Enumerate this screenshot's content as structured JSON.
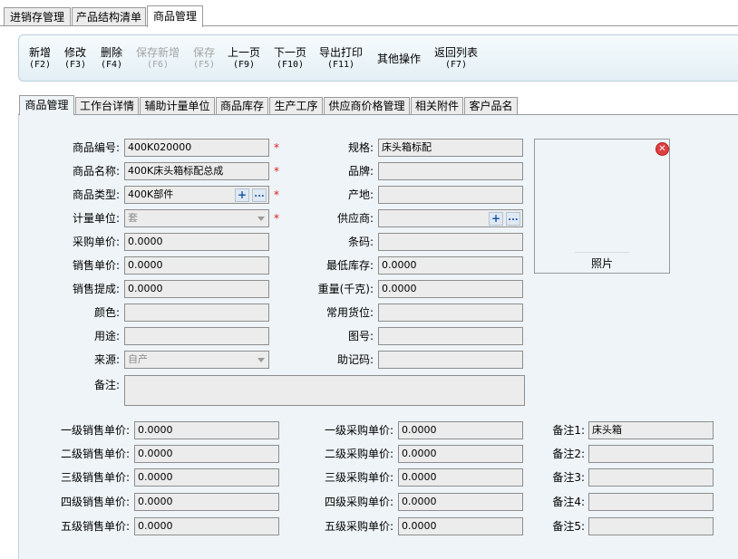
{
  "top_tabs": [
    "进销存管理",
    "产品结构清单",
    "商品管理"
  ],
  "toolbar": {
    "new": {
      "label": "新增",
      "key": "(F2)"
    },
    "edit": {
      "label": "修改",
      "key": "(F3)"
    },
    "delete": {
      "label": "删除",
      "key": "(F4)"
    },
    "save_new": {
      "label": "保存新增",
      "key": "(F6)"
    },
    "save": {
      "label": "保存",
      "key": "(F5)"
    },
    "prev": {
      "label": "上一页",
      "key": "(F9)"
    },
    "next": {
      "label": "下一页",
      "key": "(F10)"
    },
    "export": {
      "label": "导出打印",
      "key": "(F11)"
    },
    "other": {
      "label": "其他操作"
    },
    "back": {
      "label": "返回列表",
      "key": "(F7)"
    }
  },
  "detail_tabs": [
    "商品管理",
    "工作台详情",
    "辅助计量单位",
    "商品库存",
    "生产工序",
    "供应商价格管理",
    "相关附件",
    "客户品名"
  ],
  "form": {
    "code": {
      "label": "商品编号:",
      "value": "400K020000"
    },
    "name": {
      "label": "商品名称:",
      "value": "400K床头箱标配总成"
    },
    "type": {
      "label": "商品类型:",
      "value": "400K部件"
    },
    "unit": {
      "label": "计量单位:",
      "value": "套"
    },
    "purchase_price": {
      "label": "采购单价:",
      "value": "0.0000"
    },
    "sale_price": {
      "label": "销售单价:",
      "value": "0.0000"
    },
    "commission": {
      "label": "销售提成:",
      "value": "0.0000"
    },
    "color": {
      "label": "颜色:",
      "value": ""
    },
    "usage": {
      "label": "用途:",
      "value": ""
    },
    "source": {
      "label": "来源:",
      "value": "自产"
    },
    "remark": {
      "label": "备注:",
      "value": ""
    },
    "spec": {
      "label": "规格:",
      "value": "床头箱标配"
    },
    "brand": {
      "label": "品牌:",
      "value": ""
    },
    "origin": {
      "label": "产地:",
      "value": ""
    },
    "supplier": {
      "label": "供应商:",
      "value": ""
    },
    "barcode": {
      "label": "条码:",
      "value": ""
    },
    "min_stock": {
      "label": "最低库存:",
      "value": "0.0000"
    },
    "weight": {
      "label": "重量(千克):",
      "value": "0.0000"
    },
    "location": {
      "label": "常用货位:",
      "value": ""
    },
    "drawing_no": {
      "label": "图号:",
      "value": ""
    },
    "mnemonic": {
      "label": "助记码:",
      "value": ""
    },
    "photo_label": "照片",
    "required_mark": "*",
    "plus": "+",
    "ellipsis": "..."
  },
  "price_levels": {
    "sale": [
      {
        "label": "一级销售单价:",
        "value": "0.0000"
      },
      {
        "label": "二级销售单价:",
        "value": "0.0000"
      },
      {
        "label": "三级销售单价:",
        "value": "0.0000"
      },
      {
        "label": "四级销售单价:",
        "value": "0.0000"
      },
      {
        "label": "五级销售单价:",
        "value": "0.0000"
      }
    ],
    "purchase": [
      {
        "label": "一级采购单价:",
        "value": "0.0000"
      },
      {
        "label": "二级采购单价:",
        "value": "0.0000"
      },
      {
        "label": "三级采购单价:",
        "value": "0.0000"
      },
      {
        "label": "四级采购单价:",
        "value": "0.0000"
      },
      {
        "label": "五级采购单价:",
        "value": "0.0000"
      }
    ],
    "notes": [
      {
        "label": "备注1:",
        "value": "床头箱"
      },
      {
        "label": "备注2:",
        "value": ""
      },
      {
        "label": "备注3:",
        "value": ""
      },
      {
        "label": "备注4:",
        "value": ""
      },
      {
        "label": "备注5:",
        "value": ""
      }
    ]
  }
}
